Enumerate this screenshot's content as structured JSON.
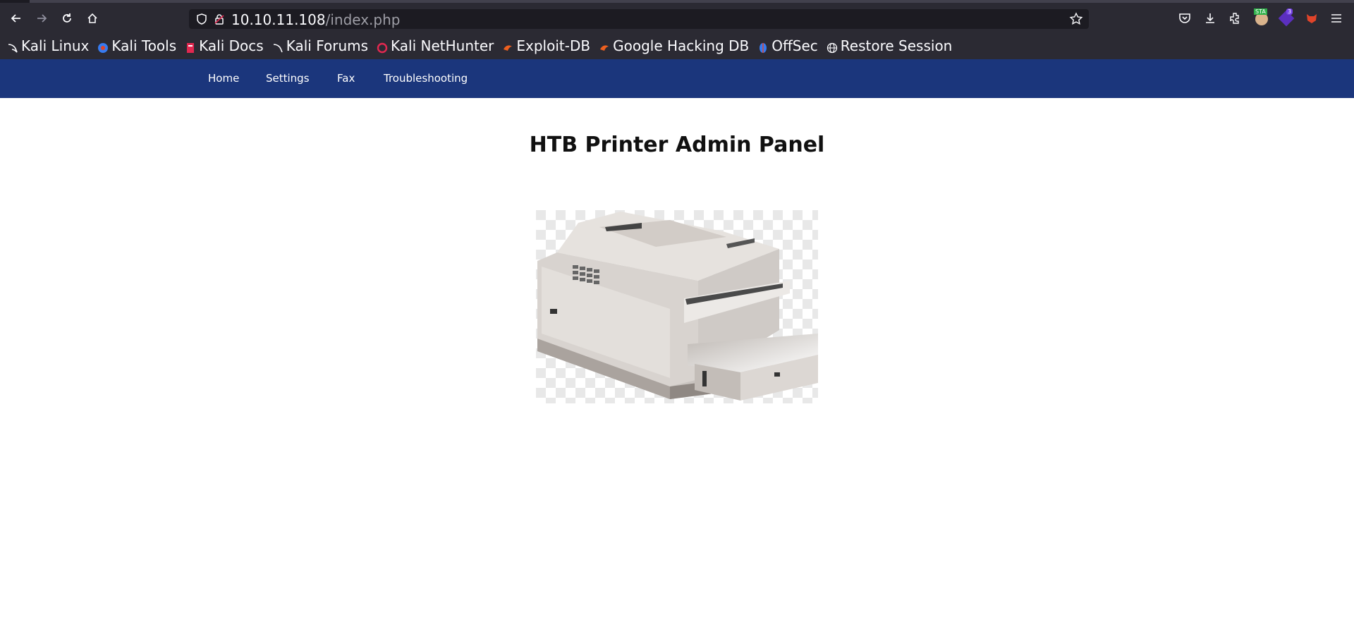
{
  "browser": {
    "url_host": "10.10.11.108",
    "url_path": "/index.php",
    "icons": [
      "back-icon",
      "forward-icon",
      "reload-icon",
      "home-icon",
      "shield-icon",
      "lock-icon",
      "bookmark-star-icon",
      "pocket-icon",
      "downloads-icon",
      "extensions-icon",
      "menu-icon"
    ],
    "extension_badge": "3",
    "extension_label": "STA"
  },
  "bookmarks": [
    {
      "label": "Kali Linux",
      "icon": "kali-dragon-icon"
    },
    {
      "label": "Kali Tools",
      "icon": "kali-tools-icon"
    },
    {
      "label": "Kali Docs",
      "icon": "kali-docs-icon"
    },
    {
      "label": "Kali Forums",
      "icon": "kali-forums-icon"
    },
    {
      "label": "Kali NetHunter",
      "icon": "nethunter-icon"
    },
    {
      "label": "Exploit-DB",
      "icon": "exploit-db-icon"
    },
    {
      "label": "Google Hacking DB",
      "icon": "ghdb-icon"
    },
    {
      "label": "OffSec",
      "icon": "offsec-icon"
    },
    {
      "label": "Restore Session",
      "icon": "globe-icon"
    }
  ],
  "site": {
    "nav": [
      "Home",
      "Settings",
      "Fax",
      "Troubleshooting"
    ],
    "title": "HTB Printer Admin Panel",
    "colors": {
      "nav_bg": "#1b367c",
      "chrome_bg": "#2b2a33"
    }
  }
}
